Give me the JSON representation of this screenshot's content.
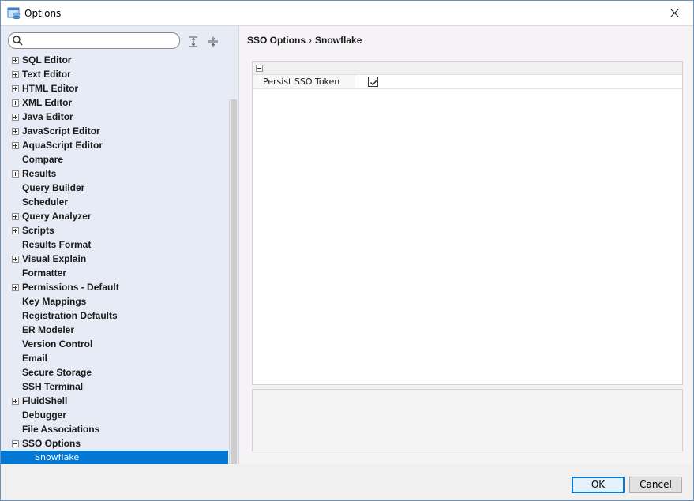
{
  "window": {
    "title": "Options"
  },
  "search": {
    "value": "",
    "placeholder": ""
  },
  "tree": {
    "items": [
      {
        "label": "SQL Editor",
        "expander": "plus"
      },
      {
        "label": "Text Editor",
        "expander": "plus"
      },
      {
        "label": "HTML Editor",
        "expander": "plus"
      },
      {
        "label": "XML Editor",
        "expander": "plus"
      },
      {
        "label": "Java Editor",
        "expander": "plus"
      },
      {
        "label": "JavaScript Editor",
        "expander": "plus"
      },
      {
        "label": "AquaScript Editor",
        "expander": "plus"
      },
      {
        "label": "Compare",
        "expander": "none"
      },
      {
        "label": "Results",
        "expander": "plus"
      },
      {
        "label": "Query Builder",
        "expander": "none"
      },
      {
        "label": "Scheduler",
        "expander": "none"
      },
      {
        "label": "Query Analyzer",
        "expander": "plus"
      },
      {
        "label": "Scripts",
        "expander": "plus"
      },
      {
        "label": "Results Format",
        "expander": "none"
      },
      {
        "label": "Visual Explain",
        "expander": "plus"
      },
      {
        "label": "Formatter",
        "expander": "none"
      },
      {
        "label": "Permissions - Default",
        "expander": "plus"
      },
      {
        "label": "Key Mappings",
        "expander": "none"
      },
      {
        "label": "Registration Defaults",
        "expander": "none"
      },
      {
        "label": "ER Modeler",
        "expander": "none"
      },
      {
        "label": "Version Control",
        "expander": "none"
      },
      {
        "label": "Email",
        "expander": "none"
      },
      {
        "label": "Secure Storage",
        "expander": "none"
      },
      {
        "label": "SSH Terminal",
        "expander": "none"
      },
      {
        "label": "FluidShell",
        "expander": "plus"
      },
      {
        "label": "Debugger",
        "expander": "none"
      },
      {
        "label": "File Associations",
        "expander": "none"
      },
      {
        "label": "SSO Options",
        "expander": "minus"
      },
      {
        "label": "Snowflake",
        "expander": "child",
        "selected": true
      }
    ]
  },
  "breadcrumb": {
    "parent": "SSO Options",
    "separator": "›",
    "current": "Snowflake"
  },
  "properties": {
    "rows": [
      {
        "name": "Persist SSO Token",
        "checked": true
      }
    ]
  },
  "buttons": {
    "ok": "OK",
    "cancel": "Cancel"
  },
  "colors": {
    "selection": "#0078d7",
    "tree_background": "#e7ebf6"
  }
}
